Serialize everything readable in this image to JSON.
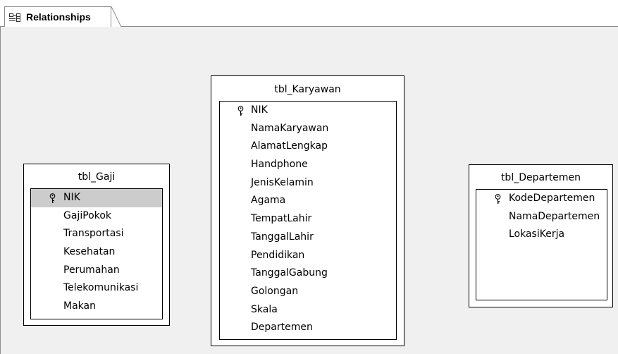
{
  "tab": {
    "label": "Relationships",
    "icon": "relationships-icon"
  },
  "tables": {
    "gaji": {
      "name": "tbl_Gaji",
      "fields": [
        {
          "label": "NIK",
          "key": true,
          "selected": true
        },
        {
          "label": "GajiPokok"
        },
        {
          "label": "Transportasi"
        },
        {
          "label": "Kesehatan"
        },
        {
          "label": "Perumahan"
        },
        {
          "label": "Telekomunikasi"
        },
        {
          "label": "Makan"
        }
      ]
    },
    "karyawan": {
      "name": "tbl_Karyawan",
      "fields": [
        {
          "label": "NIK",
          "key": true
        },
        {
          "label": "NamaKaryawan"
        },
        {
          "label": "AlamatLengkap"
        },
        {
          "label": "Handphone"
        },
        {
          "label": "JenisKelamin"
        },
        {
          "label": "Agama"
        },
        {
          "label": "TempatLahir"
        },
        {
          "label": "TanggalLahir"
        },
        {
          "label": "Pendidikan"
        },
        {
          "label": "TanggalGabung"
        },
        {
          "label": "Golongan"
        },
        {
          "label": "Skala"
        },
        {
          "label": "Departemen"
        }
      ]
    },
    "departemen": {
      "name": "tbl_Departemen",
      "fields": [
        {
          "label": "KodeDepartemen",
          "key": true
        },
        {
          "label": "NamaDepartemen"
        },
        {
          "label": "LokasiKerja"
        }
      ]
    }
  }
}
